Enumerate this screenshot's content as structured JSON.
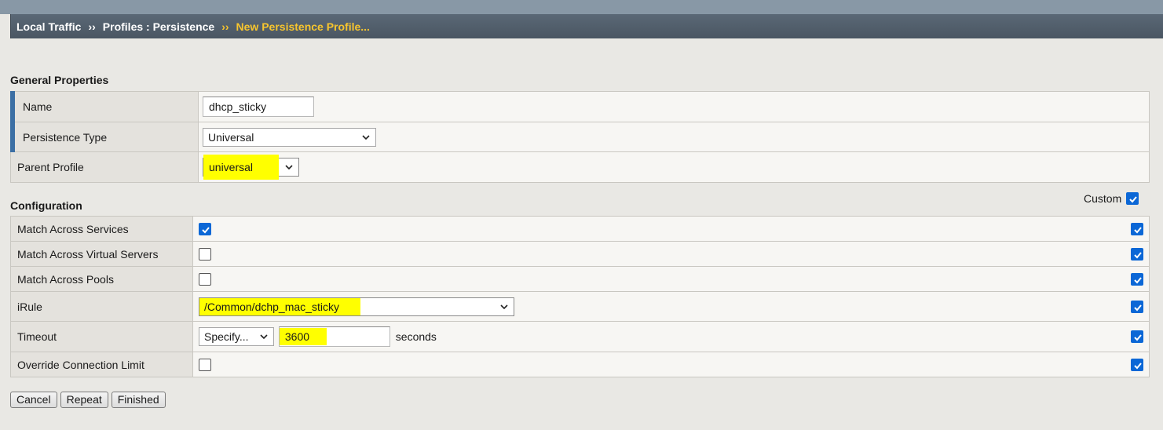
{
  "breadcrumb": {
    "item1": "Local Traffic",
    "sep": "››",
    "item2": "Profiles : Persistence",
    "current": "New Persistence Profile..."
  },
  "general": {
    "title": "General Properties",
    "name_label": "Name",
    "name_value": "dhcp_sticky",
    "type_label": "Persistence Type",
    "type_value": "Universal",
    "parent_label": "Parent Profile",
    "parent_value": "universal"
  },
  "config": {
    "title": "Configuration",
    "custom_label": "Custom",
    "custom_checked": true,
    "rows": {
      "match_services": {
        "label": "Match Across Services",
        "checked": true,
        "custom": true
      },
      "match_virtual": {
        "label": "Match Across Virtual Servers",
        "checked": false,
        "custom": true
      },
      "match_pools": {
        "label": "Match Across Pools",
        "checked": false,
        "custom": true
      },
      "irule": {
        "label": "iRule",
        "value": "/Common/dchp_mac_sticky",
        "custom": true
      },
      "timeout": {
        "label": "Timeout",
        "mode": "Specify...",
        "value": "3600",
        "unit": "seconds",
        "custom": true
      },
      "override": {
        "label": "Override Connection Limit",
        "checked": false,
        "custom": true
      }
    }
  },
  "buttons": {
    "cancel": "Cancel",
    "repeat": "Repeat",
    "finished": "Finished"
  },
  "colors": {
    "highlight": "#ffff00",
    "checkbox": "#0b67d6",
    "breadcrumb_current": "#f7c52e",
    "required_bar": "#3c6fa4"
  }
}
